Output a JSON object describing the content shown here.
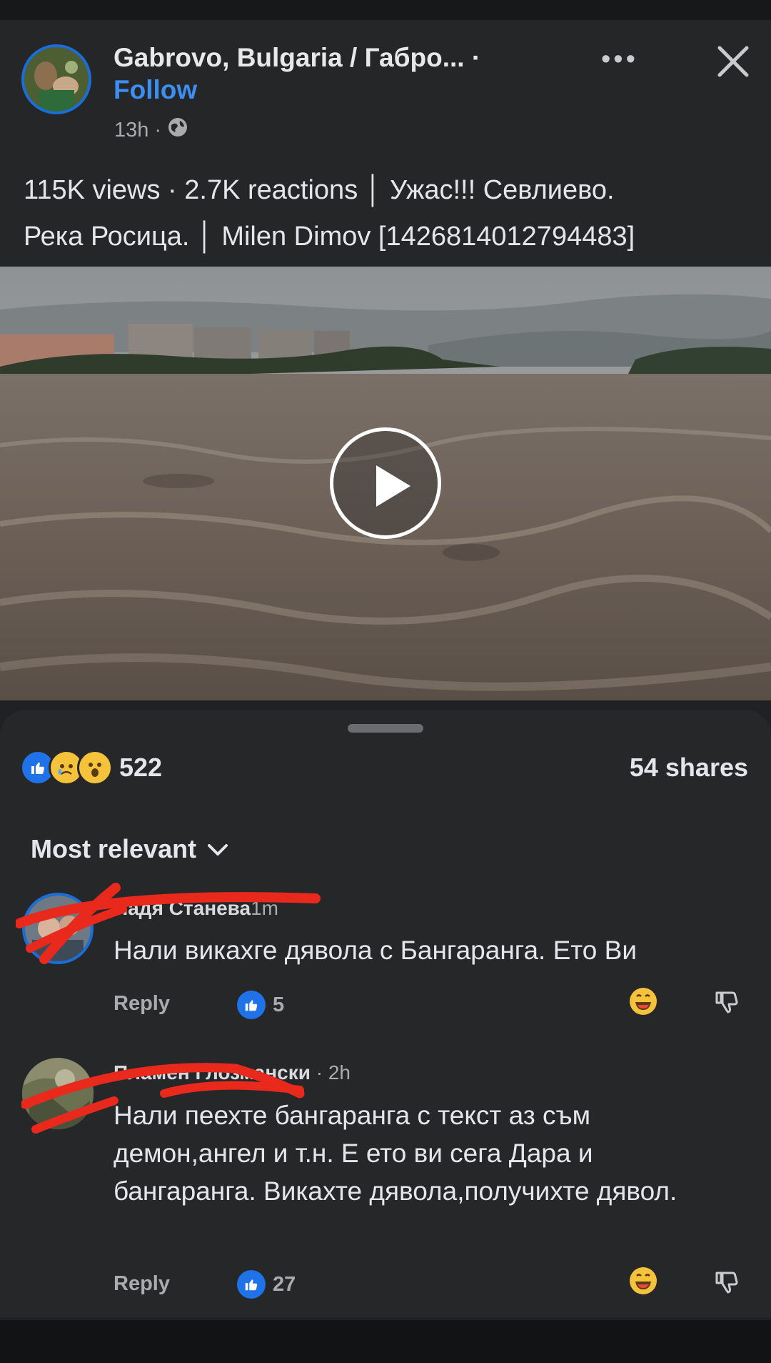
{
  "post": {
    "page_name": "Gabrovo, Bulgaria / Габро... ·",
    "follow_label": "Follow",
    "time": "13h",
    "time_separator": "·",
    "more_label": "•••",
    "description_line1": "115K views · 2.7K reactions │ Ужас!!! Севлиево.",
    "description_line2": "Река Росица. │ Milen Dimov [1426814012794483]"
  },
  "reactions": {
    "count": "522",
    "shares": "54 shares",
    "icons": [
      "like-icon",
      "sad-icon",
      "wow-icon"
    ]
  },
  "sort": {
    "label": "Most relevant"
  },
  "comments": [
    {
      "name": "Надя Станева",
      "time": "1m",
      "text": "Нали викахге дявола с Бангаранга.  Ето Ви",
      "reply_label": "Reply",
      "likes": "5"
    },
    {
      "name": "Пламен Глозмански",
      "time": " · 2h",
      "text": "Нали пеехте бангаранга с текст аз съм демон,ангел и т.н. Е ето ви сега Дара и бангаранга. Викахте дявола,получихте дявол.",
      "reply_label": "Reply",
      "likes": "27"
    }
  ],
  "colors": {
    "background": "#202124",
    "accent_blue": "#3c8ff0",
    "like_blue": "#1f72e8",
    "scribble_red": "#e8291c"
  }
}
